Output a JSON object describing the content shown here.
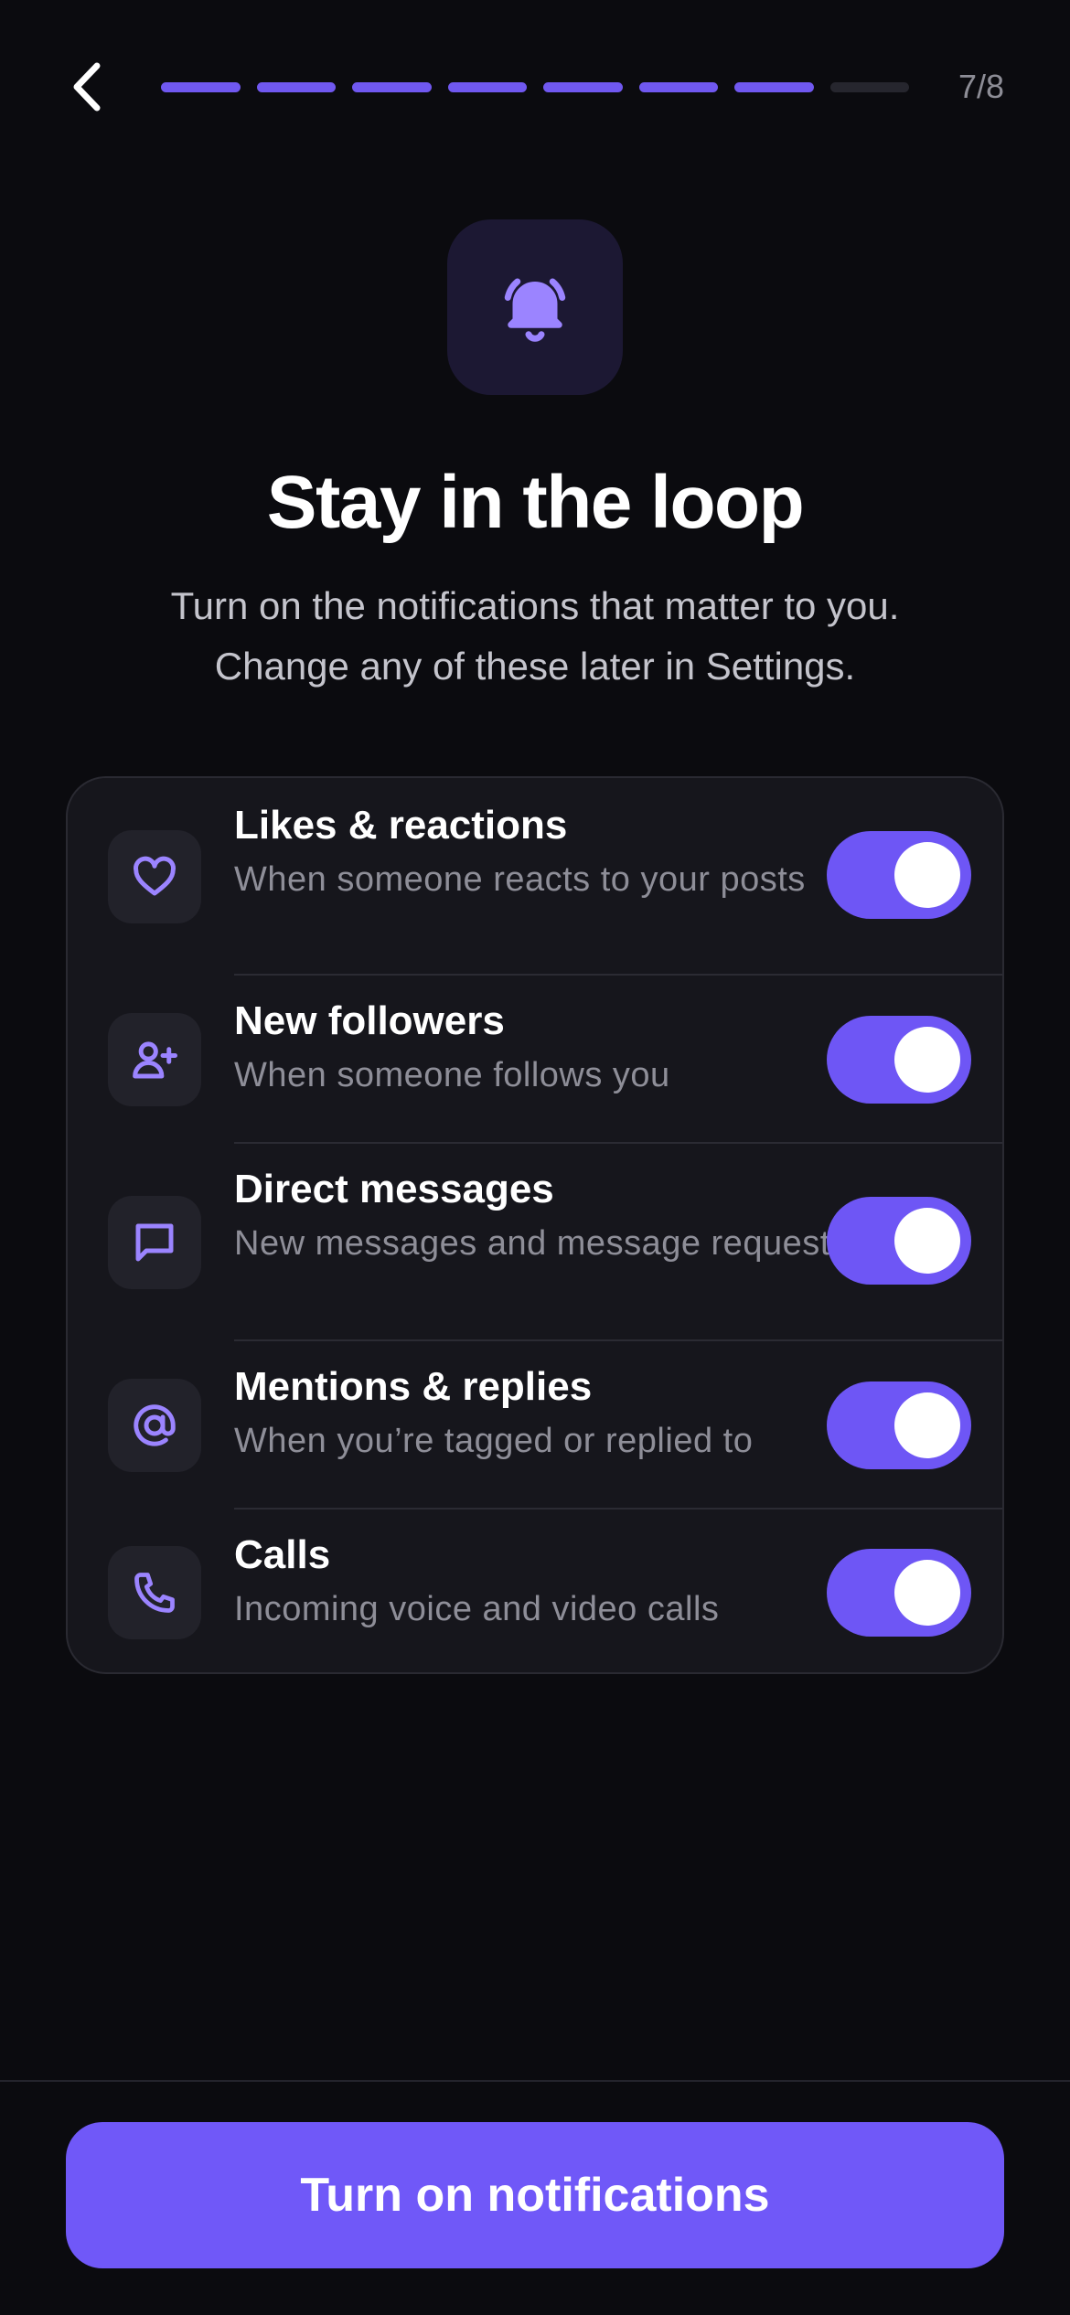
{
  "header": {
    "step_count": "7/8",
    "progress": {
      "current": 7,
      "total": 8
    }
  },
  "hero": {
    "icon": "bell-alert-icon",
    "title": "Stay in the loop",
    "subtitle_line1": "Turn on the notifications that matter to you.",
    "subtitle_line2": "Change any of these later in Settings."
  },
  "settings": [
    {
      "icon": "heart-icon",
      "label": "Likes & reactions",
      "desc": "When someone reacts to your posts",
      "enabled": true
    },
    {
      "icon": "user-plus-icon",
      "label": "New followers",
      "desc": "When someone follows you",
      "enabled": true
    },
    {
      "icon": "message-icon",
      "label": "Direct messages",
      "desc": "New messages and message requests",
      "enabled": true
    },
    {
      "icon": "at-sign-icon",
      "label": "Mentions & replies",
      "desc": "When you’re tagged or replied to",
      "enabled": true
    },
    {
      "icon": "phone-icon",
      "label": "Calls",
      "desc": "Incoming voice and video calls",
      "enabled": true
    }
  ],
  "footer": {
    "cta_label": "Turn on notifications"
  },
  "colors": {
    "accent": "#7058f8",
    "background": "#0b0b0f",
    "card": "#16161c"
  }
}
